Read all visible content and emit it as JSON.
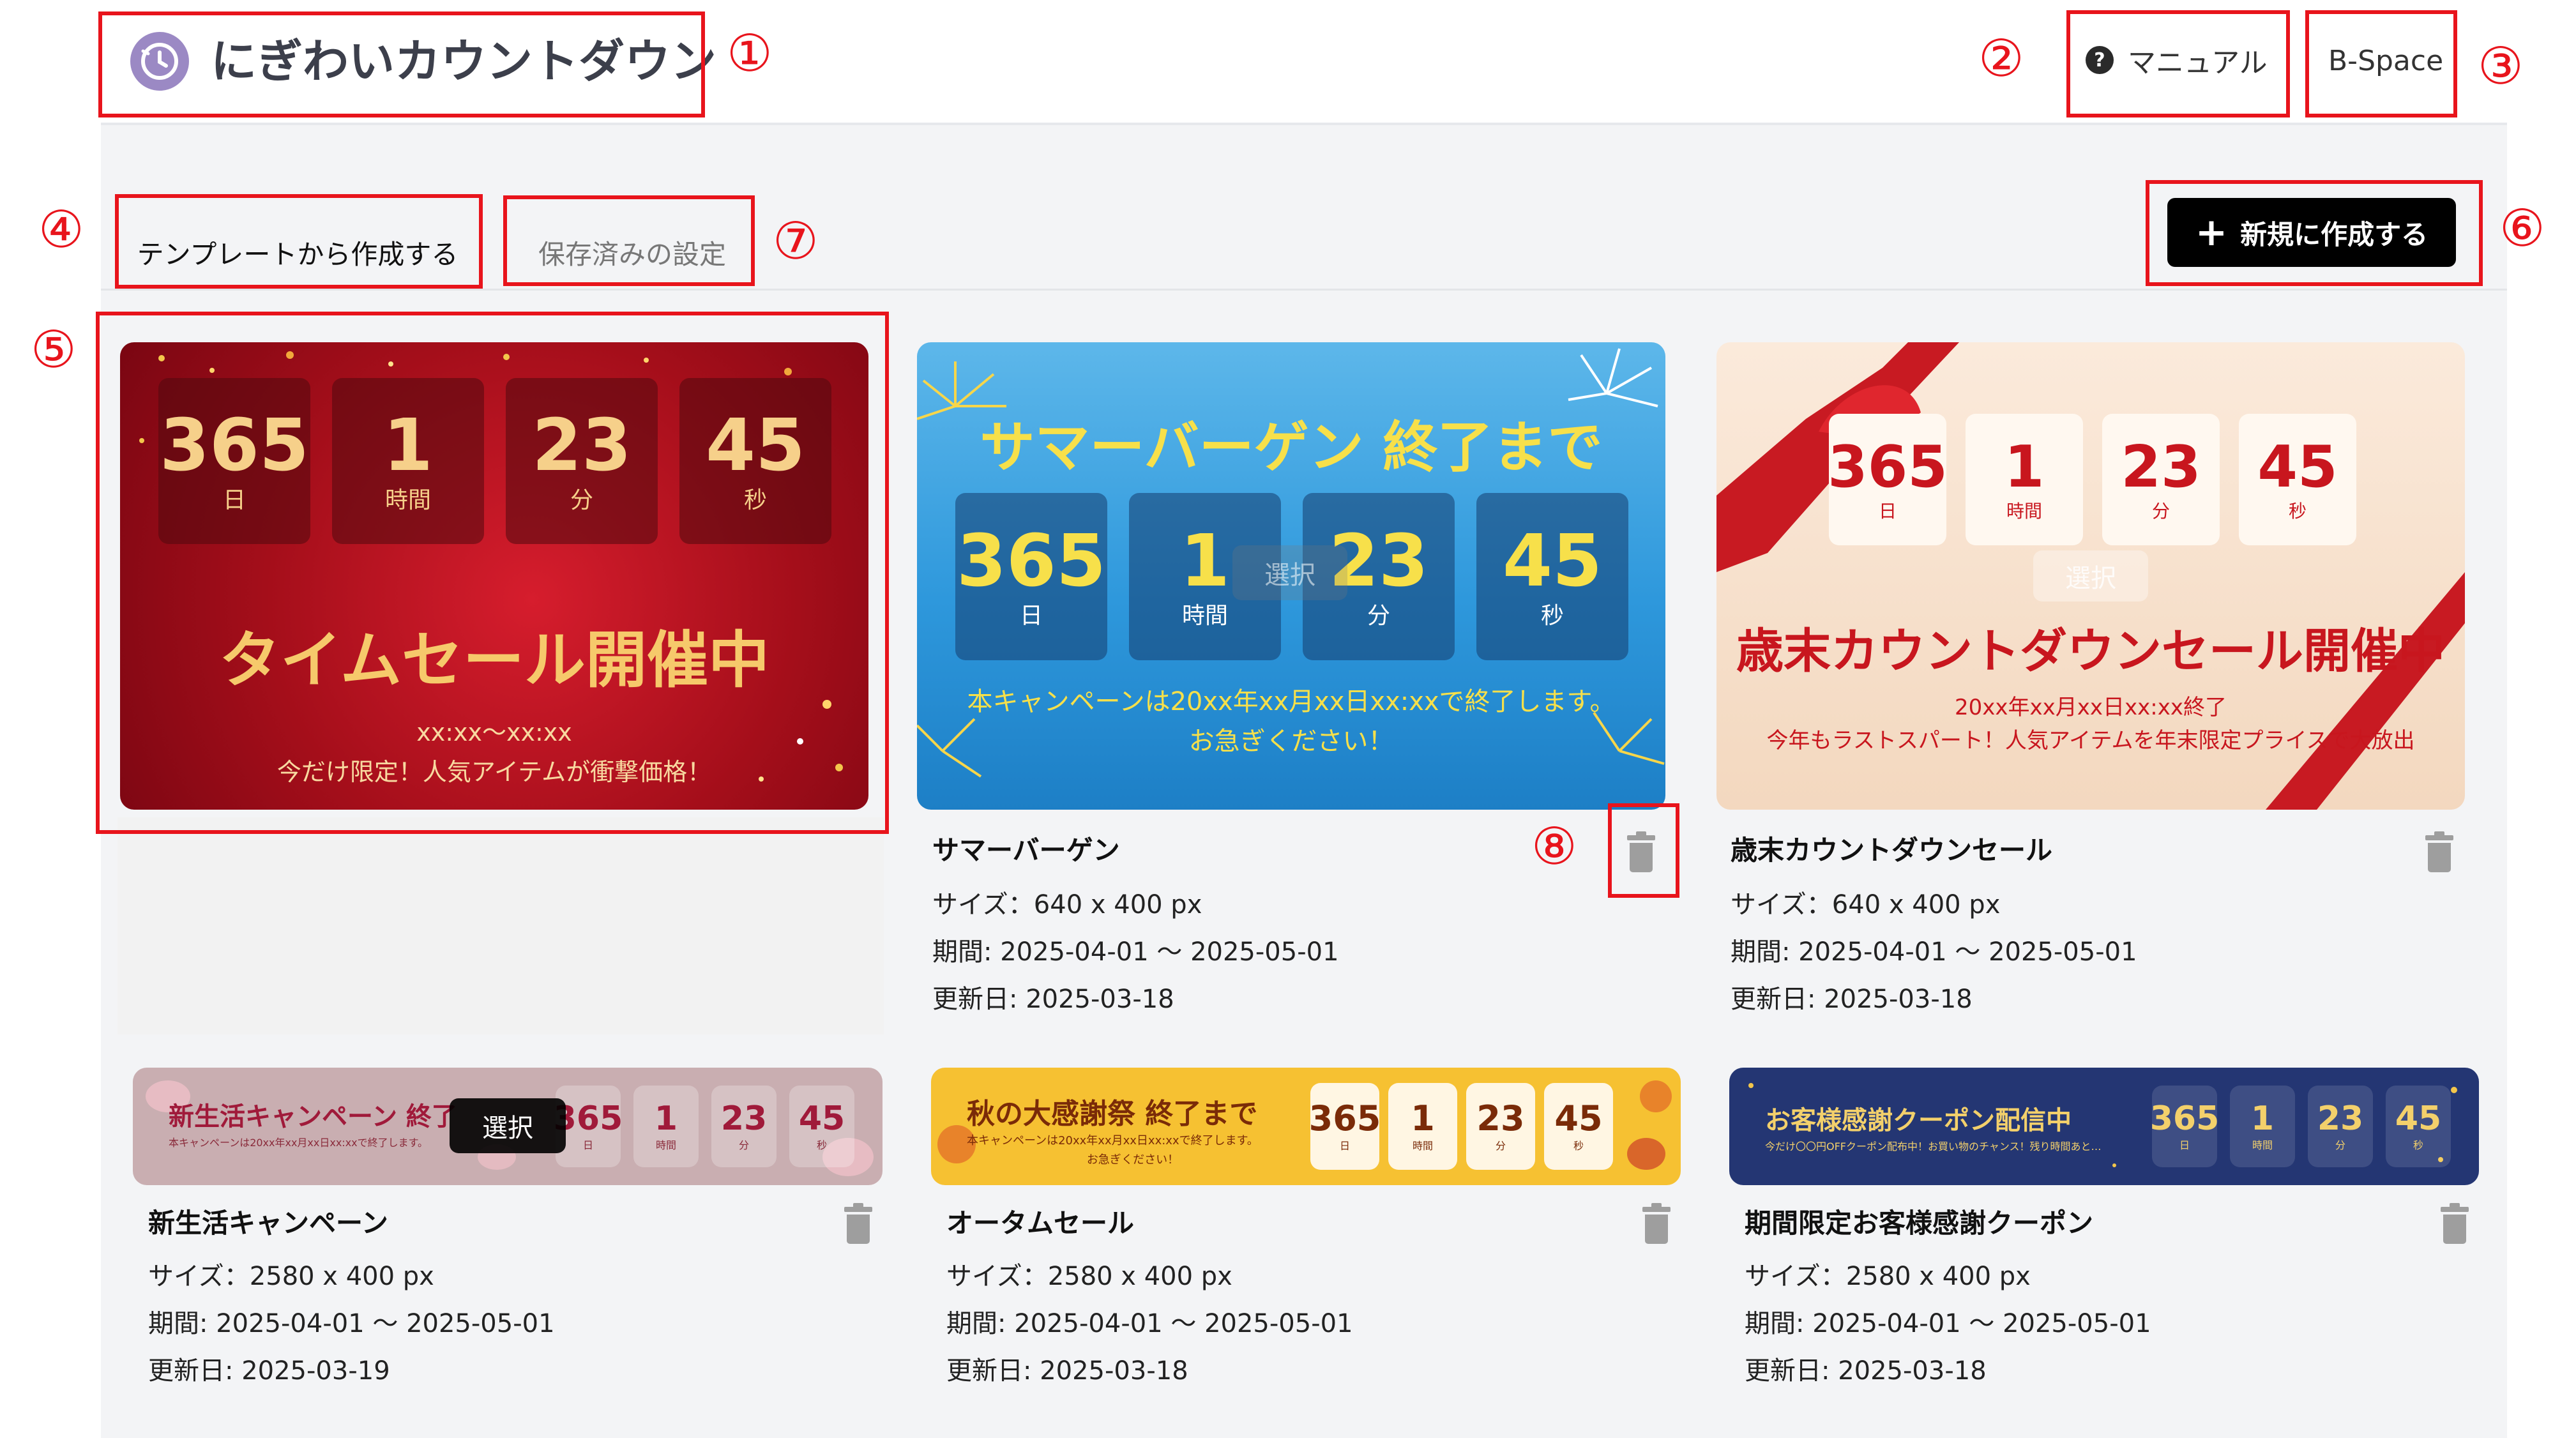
{
  "header": {
    "app_title": "にぎわいカウントダウン",
    "manual_label": "マニュアル",
    "help_glyph": "?",
    "space_label": "B-Space"
  },
  "tabs": [
    {
      "label": "テンプレートから作成する",
      "active": true
    },
    {
      "label": "保存済みの設定",
      "active": false
    }
  ],
  "new_button": {
    "icon": "+",
    "label": "新規に作成する"
  },
  "callouts": [
    "①",
    "②",
    "③",
    "④",
    "⑤",
    "⑥",
    "⑦",
    "⑧"
  ],
  "countdown": {
    "days": "365",
    "hours": "1",
    "minutes": "23",
    "seconds": "45",
    "day_unit": "日",
    "hour_unit": "時間",
    "minute_unit": "分",
    "second_unit": "秒"
  },
  "select_label": "選択",
  "cards": [
    {
      "heading": "タイムセール開催中",
      "subline1": "xx:xx〜xx:xx",
      "subline2": "今だけ限定！人気アイテムが衝撃価格！"
    },
    {
      "heading": "サマーバーゲン 終了まで",
      "subline1": "本キャンペーンは20xx年xx月xx日xx:xxで終了します。",
      "subline2": "お急ぎください！",
      "title": "サマーバーゲン",
      "size": "サイズ：640 x 400 px",
      "period": "期間: 2025-04-01 〜 2025-05-01",
      "updated": "更新日: 2025-03-18"
    },
    {
      "heading": "歳末カウントダウンセール開催中",
      "subline1": "20xx年xx月xx日xx:xx終了",
      "subline2": "今年もラストスパート！人気アイテムを年末限定プライスで大放出",
      "title": "歳末カウントダウンセール",
      "size": "サイズ：640 x 400 px",
      "period": "期間: 2025-04-01 〜 2025-05-01",
      "updated": "更新日: 2025-03-18"
    },
    {
      "heading": "新生活キャンペーン 終了",
      "subline1": "本キャンペーンは20xx年xx月xx日xx:xxで終了します。",
      "title": "新生活キャンペーン",
      "size": "サイズ：2580 x 400 px",
      "period": "期間: 2025-04-01 〜 2025-05-01",
      "updated": "更新日: 2025-03-19"
    },
    {
      "heading": "秋の大感謝祭 終了まで",
      "subline1": "本キャンペーンは20xx年xx月xx日xx:xxで終了します。",
      "subline2": "お急ぎください！",
      "title": "オータムセール",
      "size": "サイズ：2580 x 400 px",
      "period": "期間: 2025-04-01 〜 2025-05-01",
      "updated": "更新日: 2025-03-18"
    },
    {
      "heading": "お客様感謝クーポン配信中",
      "subline1": "今だけ〇〇円OFFクーポン配布中！お買い物のチャンス！残り時間あと…",
      "title": "期間限定お客様感謝クーポン",
      "size": "サイズ：2580 x 400 px",
      "period": "期間: 2025-04-01 〜 2025-05-01",
      "updated": "更新日: 2025-03-18"
    }
  ],
  "colors": {
    "accent_red": "#e8141c",
    "logo_purple": "#9b89c4",
    "button_black": "#000000"
  }
}
